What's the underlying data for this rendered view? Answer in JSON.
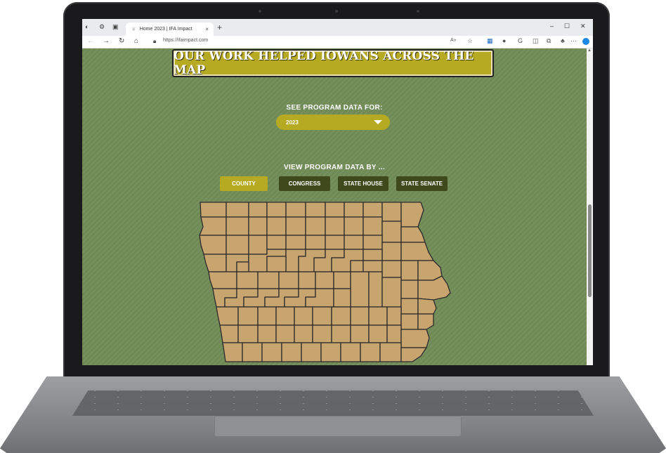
{
  "browser": {
    "tab_title": "Home 2023 | IFA Impact",
    "tab_close": "×",
    "new_tab": "+",
    "url": "https://ifaimpact.com",
    "window_minimize": "–",
    "window_maximize": "☐",
    "window_close": "✕",
    "more_menu": "···",
    "read_aloud": "A»"
  },
  "page": {
    "banner_title": "OUR WORK HELPED IOWANS ACROSS THE MAP",
    "see_data_label": "SEE PROGRAM DATA FOR:",
    "year_selected": "2023",
    "view_by_label": "VIEW PROGRAM DATA BY ...",
    "view_buttons": [
      "COUNTY",
      "CONGRESS",
      "STATE HOUSE",
      "STATE SENATE"
    ],
    "active_view": "COUNTY"
  },
  "colors": {
    "page_background": "#6f8a55",
    "accent_gold": "#b6aa22",
    "button_dark": "#3f4a1c",
    "county_fill": "#c8a56e",
    "county_stroke": "#2b2b2b"
  },
  "icons": {
    "profile": "profile-icon",
    "tab_favicon": "leaf-icon",
    "dropdown": "caret-down-icon"
  }
}
